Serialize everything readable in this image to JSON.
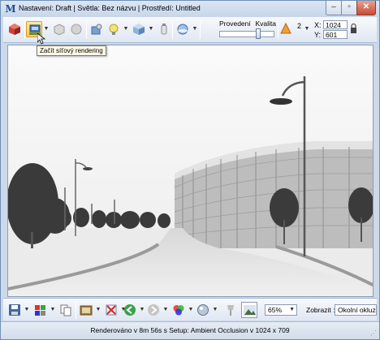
{
  "window": {
    "title": "Nastavení: Draft | Světla: Bez názvu | Prostředí: Untitled",
    "controls": {
      "minimize": "–",
      "maximize": "▫",
      "close": "✕"
    }
  },
  "toolbar_top": {
    "slider": {
      "left_label": "Provedení",
      "right_label": "Kvalita",
      "value_fraction": 0.72
    },
    "light_count": "2",
    "x_label": "X:",
    "y_label": "Y:",
    "x_value": "1024",
    "y_value": "601",
    "icons": [
      "render-cube-icon",
      "network-render-icon",
      "box-icon",
      "stop-icon",
      "tools-icon",
      "lightbulb-icon",
      "cube-icon",
      "paint-bottle-icon",
      "environment-sphere-icon",
      "warning-triangle-icon",
      "lock-icon"
    ]
  },
  "tooltip": {
    "text": "Začít síťový rendering"
  },
  "toolbar_bottom": {
    "zoom": "65%",
    "zobrazit_label": "Zobrazit :",
    "zobrazit_value": "Okolní okluze",
    "icons": [
      "save-icon",
      "color-channels-icon",
      "copy-icon",
      "image-editor-icon",
      "delete-image-icon",
      "back-arrow-icon",
      "forward-arrow-icon",
      "rgb-channels-icon",
      "sphere-icon",
      "pin-icon",
      "picture-icon"
    ]
  },
  "status": {
    "text": "Renderováno v 8m 56s s Setup: Ambient Occlusion v 1024 x 709"
  },
  "colors": {
    "accent": "#1d4f96",
    "active_button": "#f7c85a"
  }
}
